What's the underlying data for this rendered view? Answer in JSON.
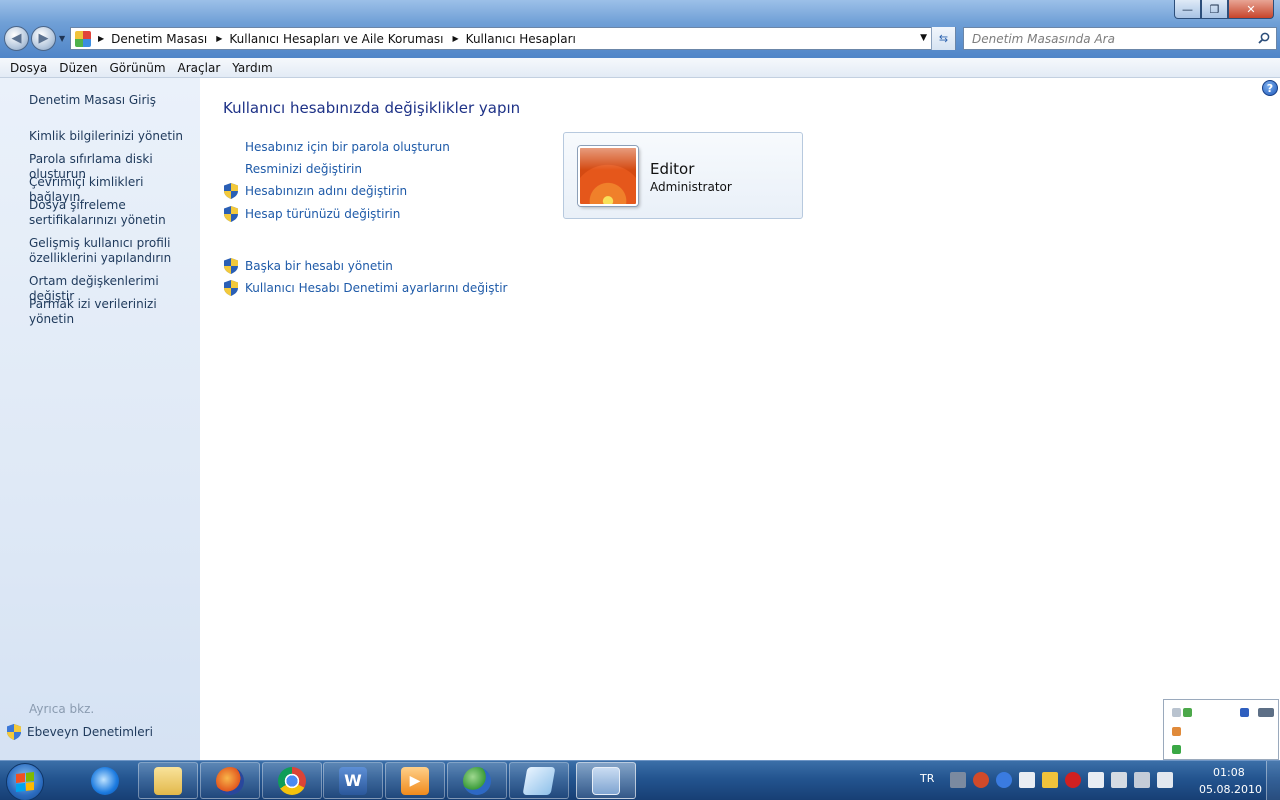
{
  "window": {
    "minimize_label": "—",
    "maximize_label": "❐",
    "close_label": "✕"
  },
  "address_bar": {
    "crumbs": [
      "Denetim Masası",
      "Kullanıcı Hesapları ve Aile Koruması",
      "Kullanıcı Hesapları"
    ]
  },
  "search": {
    "placeholder": "Denetim Masasında Ara"
  },
  "menu": {
    "items": [
      "Dosya",
      "Düzen",
      "Görünüm",
      "Araçlar",
      "Yardım"
    ]
  },
  "left_pane": {
    "home": "Denetim Masası Giriş",
    "links": [
      "Kimlik bilgilerinizi yönetin",
      "Parola sıfırlama diski oluşturun",
      "Çevrimiçi kimlikleri bağlayın",
      "Dosya şifreleme sertifikalarınızı yönetin",
      "Gelişmiş kullanıcı profili özelliklerini yapılandırın",
      "Ortam değişkenlerimi değiştir",
      "Parmak izi verilerinizi yönetin"
    ],
    "see_also": "Ayrıca bkz.",
    "parental_controls": "Ebeveyn Denetimleri"
  },
  "main": {
    "title": "Kullanıcı hesabınızda değişiklikler yapın",
    "tasks": [
      "Hesabınız için bir parola oluşturun",
      "Resminizi değiştirin",
      "Hesabınızın adını değiştirin",
      "Hesap türünüzü değiştirin"
    ],
    "other_tasks": [
      "Başka bir hesabı yönetin",
      "Kullanıcı Hesabı Denetimi ayarlarını değiştir"
    ],
    "account": {
      "name": "Editor",
      "type": "Administrator"
    },
    "help_label": "?"
  },
  "taskbar": {
    "language": "TR",
    "time": "01:08",
    "date": "05.08.2010",
    "pinned": [
      "internet-explorer-icon",
      "windows-explorer-icon",
      "firefox-icon",
      "chrome-icon",
      "word-icon",
      "media-player-icon",
      "messenger-icon",
      "notepad-icon",
      "control-panel-icon"
    ]
  },
  "colors": {
    "link": "#1e5aa8",
    "title": "#1e3287",
    "left_pane_bg": "#dfe9f6",
    "taskbar": "#23548f"
  }
}
